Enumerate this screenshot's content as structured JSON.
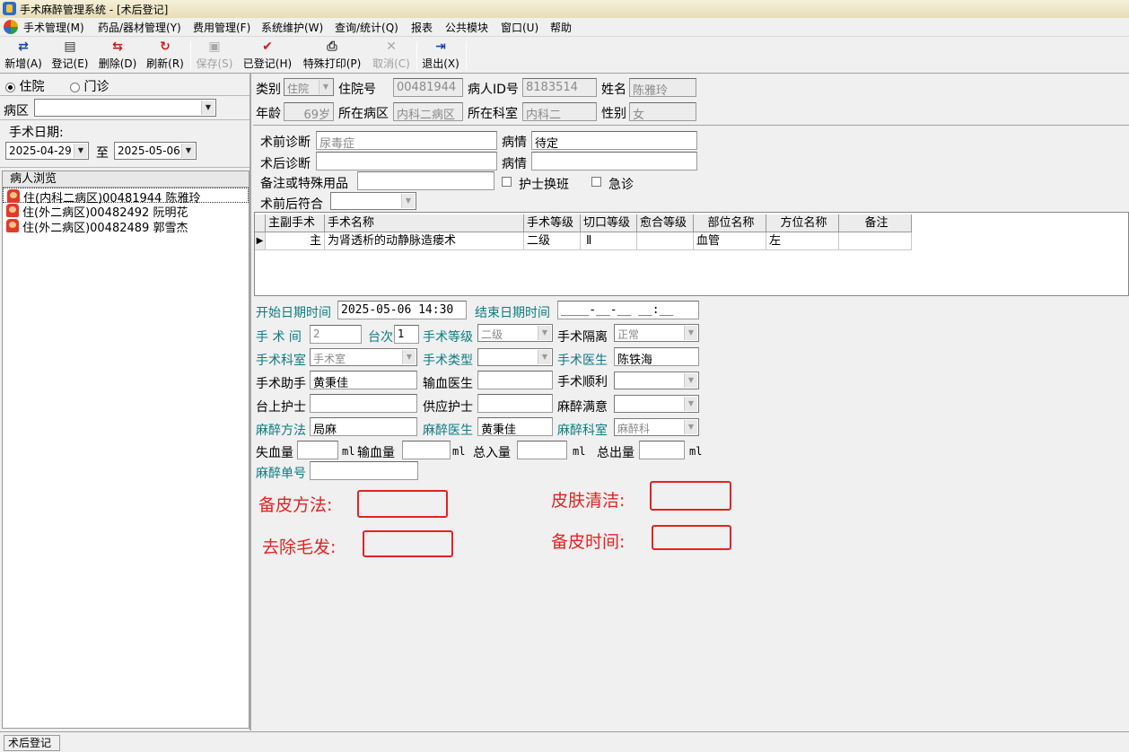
{
  "window": {
    "title": "手术麻醉管理系统 - [术后登记]"
  },
  "menu": [
    "手术管理(M)",
    "药品/器材管理(Y)",
    "费用管理(F)",
    "系统维护(W)",
    "查询/统计(Q)",
    "报表",
    "公共模块",
    "窗口(U)",
    "帮助"
  ],
  "toolbar": [
    {
      "label": "新增(A)",
      "icon": "add-icon",
      "enabled": true
    },
    {
      "label": "登记(E)",
      "icon": "register-icon",
      "enabled": true
    },
    {
      "label": "删除(D)",
      "icon": "delete-icon",
      "enabled": true
    },
    {
      "label": "刷新(R)",
      "icon": "refresh-icon",
      "enabled": true
    },
    {
      "label": "保存(S)",
      "icon": "save-icon",
      "enabled": false
    },
    {
      "label": "已登记(H)",
      "icon": "checkmark-icon",
      "enabled": true
    },
    {
      "label": "特殊打印(P)",
      "icon": "printer-icon",
      "enabled": true
    },
    {
      "label": "取消(C)",
      "icon": "cancel-icon",
      "enabled": false
    },
    {
      "label": "退出(X)",
      "icon": "exit-icon",
      "enabled": true
    }
  ],
  "left": {
    "radio_inpatient": "住院",
    "radio_outpatient": "门诊",
    "ward_label": "病区",
    "ward_value": "",
    "date_label": "手术日期:",
    "date_from": "2025-04-29",
    "date_to_label": "至",
    "date_to": "2025-05-06",
    "browse_header": "病人浏览",
    "patients": [
      "住(内科二病区)00481944  陈雅玲",
      "住(外二病区)00482492  阮明花",
      "住(外二病区)00482489  郭雪杰"
    ]
  },
  "patient": {
    "type_label": "类别",
    "type_value": "住院",
    "admission_label": "住院号",
    "admission_value": "00481944",
    "pid_label": "病人ID号",
    "pid_value": "8183514",
    "name_label": "姓名",
    "name_value": "陈雅玲",
    "age_label": "年龄",
    "age_value": "69岁",
    "ward_label": "所在病区",
    "ward_value": "内科二病区",
    "dept_label": "所在科室",
    "dept_value": "内科二",
    "sex_label": "性别",
    "sex_value": "女"
  },
  "diagnosis": {
    "pre_label": "术前诊断",
    "pre_value": "尿毒症",
    "cond1_label": "病情",
    "cond1_value": "待定",
    "post_label": "术后诊断",
    "post_value": "",
    "cond2_label": "病情",
    "cond2_value": "",
    "remark_label": "备注或特殊用品",
    "remark_value": "",
    "nurse_shift_label": "护士换班",
    "emergency_label": "急诊",
    "match_label": "术前后符合",
    "match_value": ""
  },
  "grid": {
    "headers": [
      "主副手术",
      "手术名称",
      "手术等级",
      "切口等级",
      "愈合等级",
      "部位名称",
      "方位名称",
      "备注"
    ],
    "rows": [
      [
        "主",
        "为肾透析的动静脉造瘘术",
        "二级",
        "Ⅱ",
        "",
        "血管",
        "左",
        ""
      ]
    ]
  },
  "detail": {
    "start_label": "开始日期时间",
    "start_value": "2025-05-06 14:30",
    "end_label": "结束日期时间",
    "end_value": "____-__-__ __:__",
    "room_label": "手 术 间",
    "room_value": "2",
    "seq_label": "台次",
    "seq_value": "1",
    "level_label": "手术等级",
    "level_value": "二级",
    "isolation_label": "手术隔离",
    "isolation_value": "正常",
    "dept_label": "手术科室",
    "dept_value": "手术室",
    "type_label": "手术类型",
    "type_value": "",
    "surgeon_label": "手术医生",
    "surgeon_value": "陈铁海",
    "assistant_label": "手术助手",
    "assistant_value": "黄秉佳",
    "transfusion_doc_label": "输血医生",
    "transfusion_doc_value": "",
    "smooth_label": "手术顺利",
    "smooth_value": "",
    "scrub_nurse_label": "台上护士",
    "scrub_nurse_value": "",
    "supply_nurse_label": "供应护士",
    "supply_nurse_value": "",
    "anes_satisfy_label": "麻醉满意",
    "anes_satisfy_value": "",
    "anes_method_label": "麻醉方法",
    "anes_method_value": "局麻",
    "anes_doc_label": "麻醉医生",
    "anes_doc_value": "黄秉佳",
    "anes_dept_label": "麻醉科室",
    "anes_dept_value": "麻醉科",
    "blood_loss_label": "失血量",
    "blood_in_label": "输血量",
    "total_in_label": "总入量",
    "total_out_label": "总出量",
    "unit": "ml",
    "anes_no_label": "麻醉单号",
    "anes_no_value": ""
  },
  "annotations": {
    "prep_method": "备皮方法:",
    "skin_clean": "皮肤清洁:",
    "hair_removal": "去除毛发:",
    "prep_time": "备皮时间:"
  },
  "status": {
    "panel": "术后登记"
  }
}
